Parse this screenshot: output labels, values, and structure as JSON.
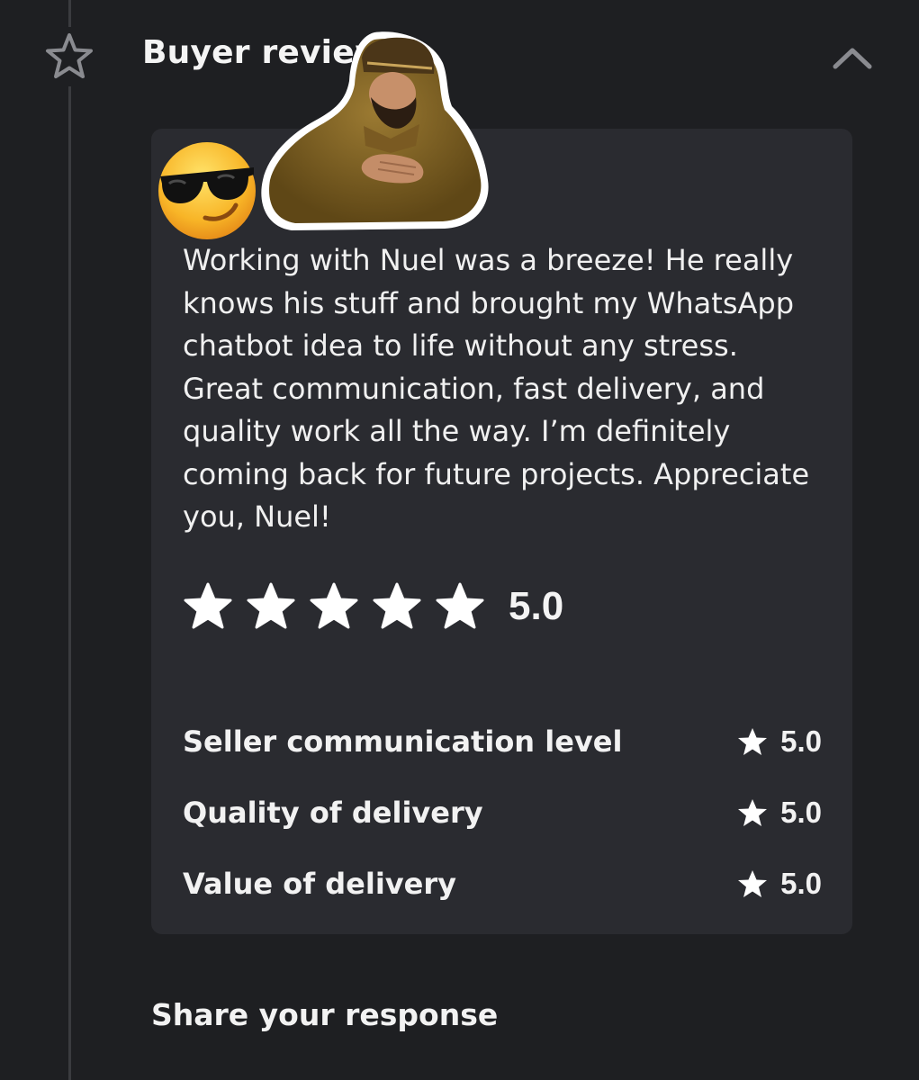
{
  "header": {
    "title": "Buyer review"
  },
  "review": {
    "lines": [
      "Working with Nuel was a breeze! He really",
      "knows his stuff and brought my WhatsApp",
      "chatbot idea to life without any stress.",
      "Great communication, fast delivery, and",
      "quality work all the way. I’m definitely",
      "coming back for future projects. Appreciate",
      "you, Nuel!"
    ],
    "stars": 5,
    "rating": "5.0"
  },
  "sub_ratings": [
    {
      "label": "Seller communication level",
      "value": "5.0"
    },
    {
      "label": "Quality of delivery",
      "value": "5.0"
    },
    {
      "label": "Value of delivery",
      "value": "5.0"
    }
  ],
  "footer": {
    "share_label": "Share your response"
  },
  "icons": {
    "section": "star-outline-icon",
    "collapse": "chevron-up-icon",
    "rating": "star-filled-icon"
  },
  "colors": {
    "background": "#1e1f22",
    "card": "#2a2b30",
    "text": "#f2f2f2",
    "icon_gray": "#8a8b90"
  }
}
